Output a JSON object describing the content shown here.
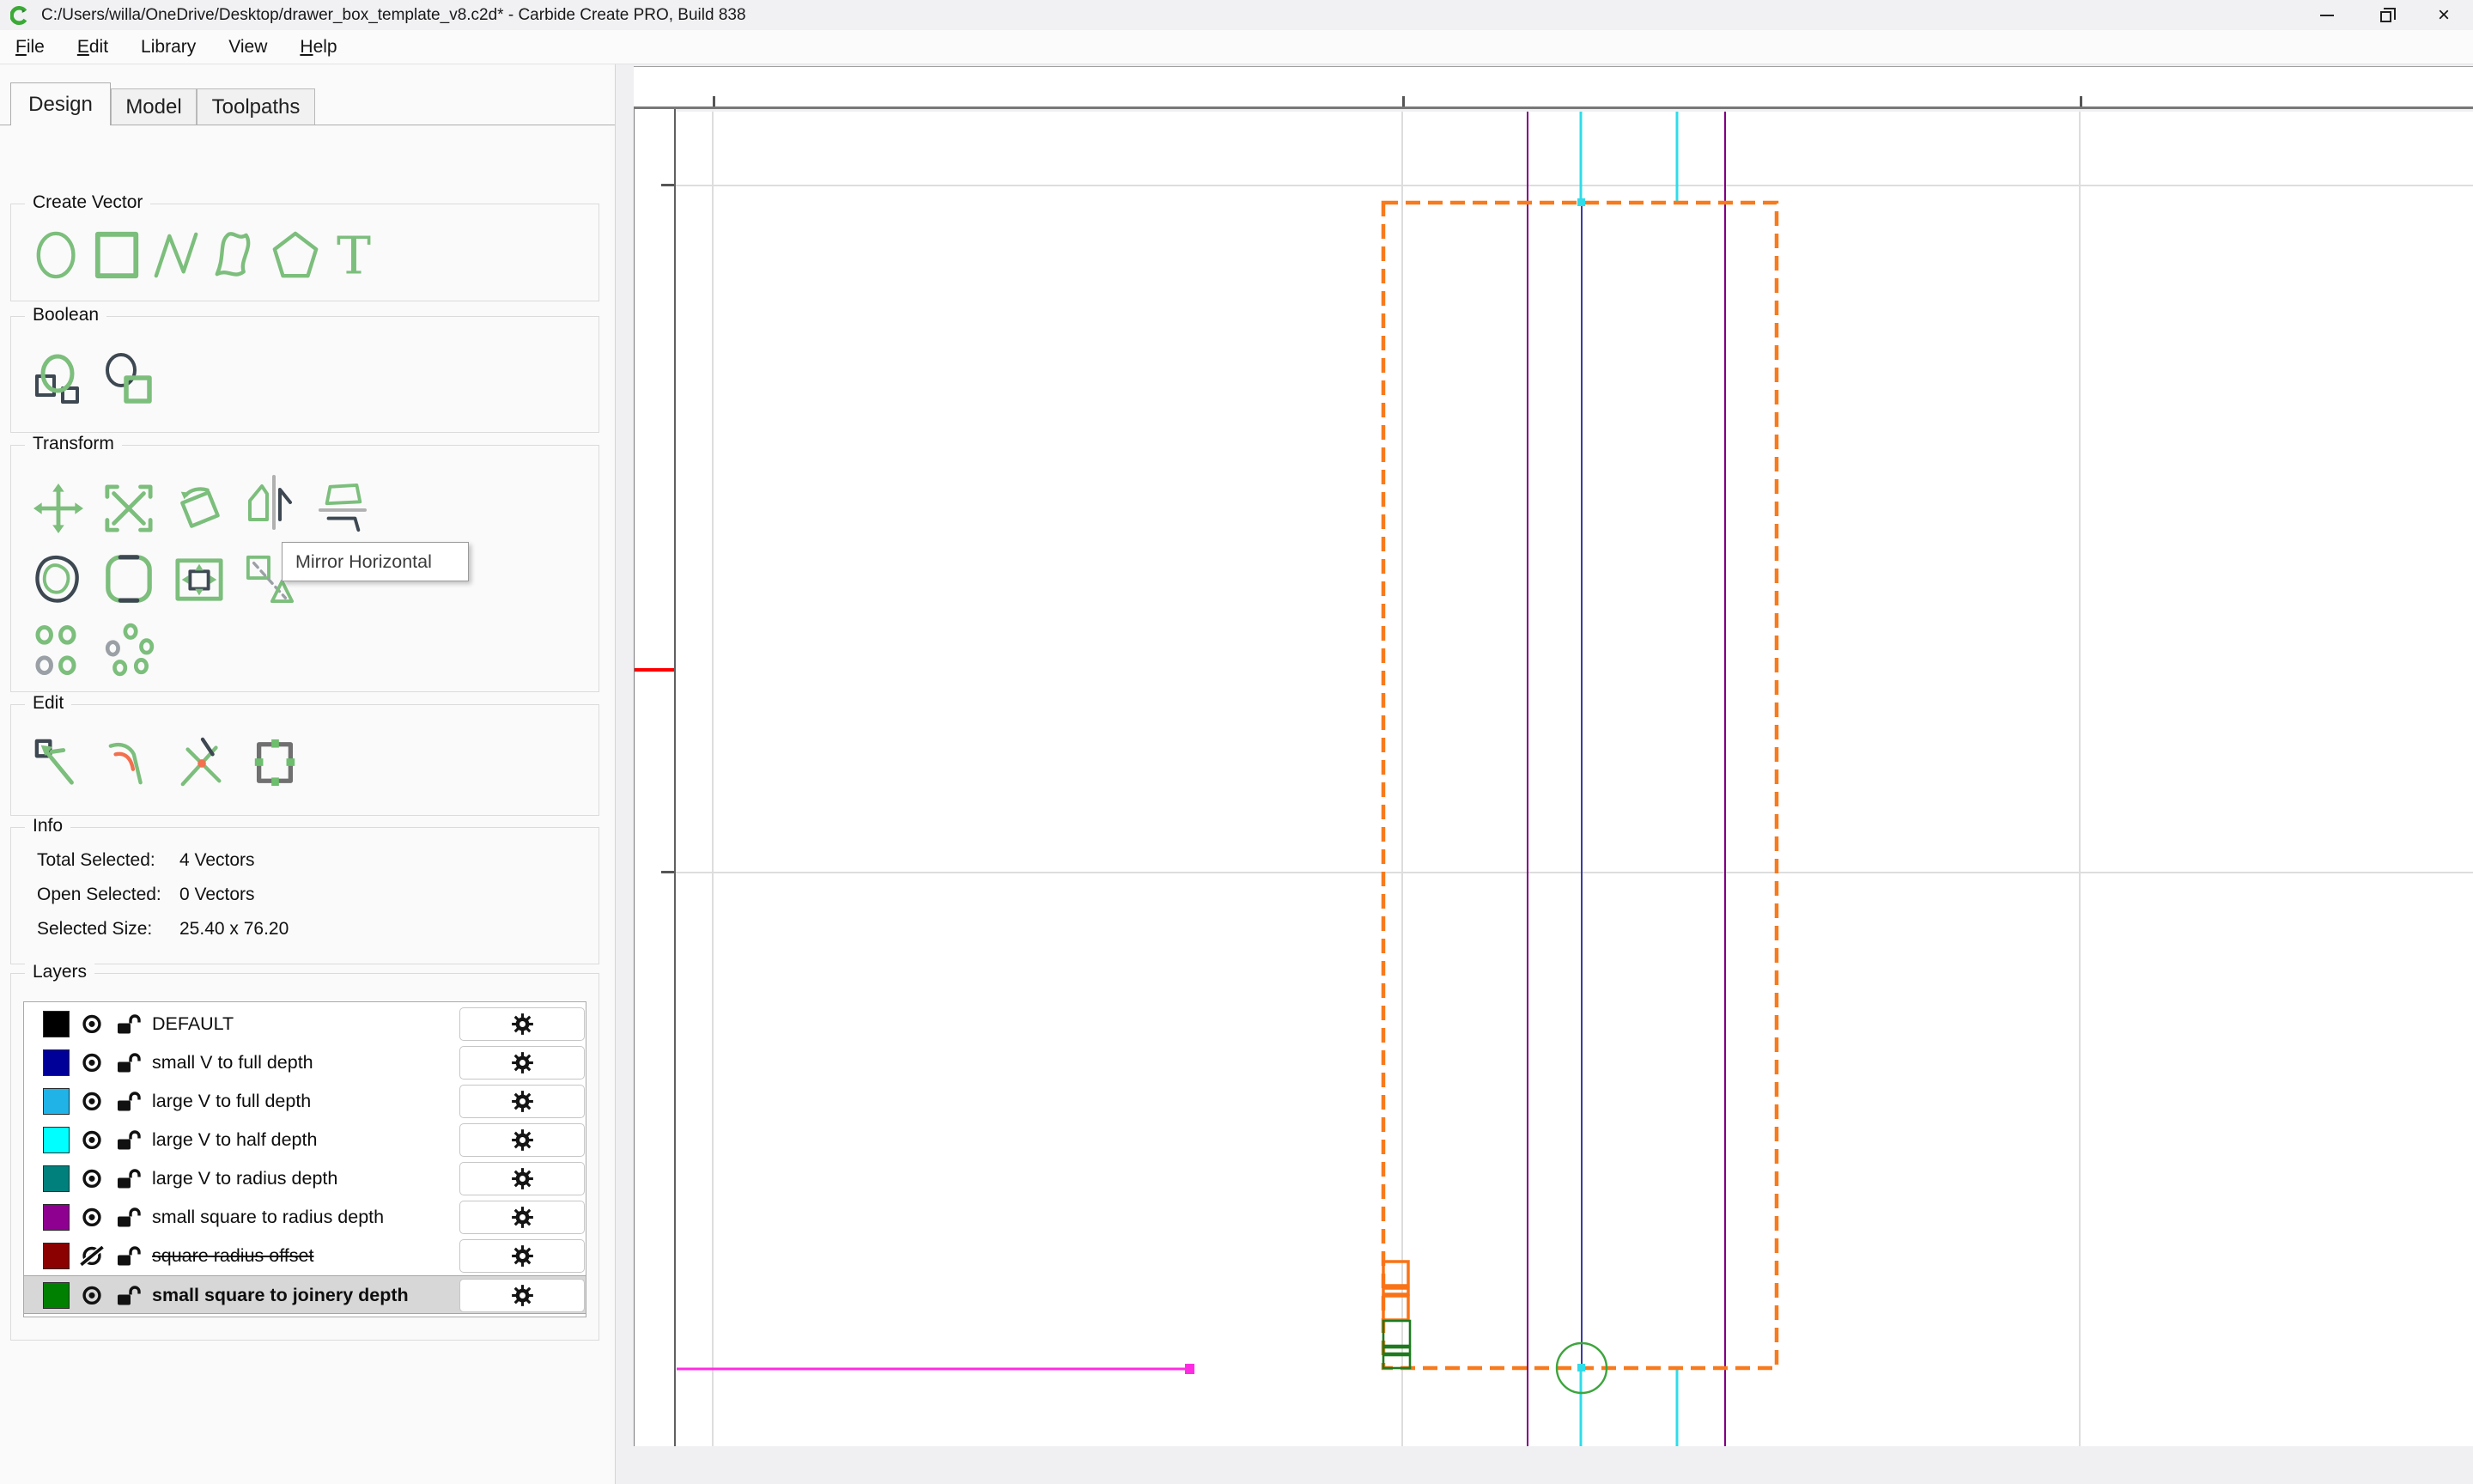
{
  "window": {
    "title": "C:/Users/willa/OneDrive/Desktop/drawer_box_template_v8.c2d* - Carbide Create PRO, Build 838",
    "controls": [
      "minimize-icon",
      "restore-icon",
      "close-icon"
    ]
  },
  "menu": {
    "items": [
      {
        "label": "File",
        "underline": 0
      },
      {
        "label": "Edit",
        "underline": 0
      },
      {
        "label": "Library"
      },
      {
        "label": "View"
      },
      {
        "label": "Help",
        "underline": 0
      }
    ]
  },
  "tabs": {
    "items": [
      "Design",
      "Model",
      "Toolpaths"
    ],
    "active": "Design"
  },
  "sections": {
    "create_vector": {
      "title": "Create Vector",
      "icons": [
        "circle-icon",
        "rectangle-icon",
        "polyline-icon",
        "curve-icon",
        "polygon-icon",
        "text-icon"
      ]
    },
    "boolean": {
      "title": "Boolean",
      "icons": [
        "boolean-union-icon",
        "boolean-subtract-icon"
      ]
    },
    "transform": {
      "title": "Transform",
      "rows": [
        [
          "move-icon",
          "scale-icon",
          "rotate-icon",
          "mirror-horizontal-icon",
          "mirror-vertical-icon"
        ],
        [
          "offset-icon",
          "round-corners-icon",
          "inset-icon",
          "trim-icon"
        ],
        [
          "linear-array-icon",
          "circular-array-icon"
        ]
      ],
      "tooltip": "Mirror Horizontal"
    },
    "edit": {
      "title": "Edit",
      "icons": [
        "node-edit-icon",
        "fillet-icon",
        "trim-vector-icon",
        "resize-icon"
      ]
    }
  },
  "info": {
    "title": "Info",
    "rows": [
      {
        "label": "Total Selected:",
        "value": "4 Vectors"
      },
      {
        "label": "Open Selected:",
        "value": "0 Vectors"
      },
      {
        "label": "Selected Size:",
        "value": "25.40 x 76.20"
      }
    ]
  },
  "layers": {
    "title": "Layers",
    "items": [
      {
        "name": "DEFAULT",
        "color": "#000000",
        "visible": true,
        "locked": false,
        "selected": false,
        "strikethrough": false
      },
      {
        "name": "small V to full depth",
        "color": "#000099",
        "visible": true,
        "locked": false,
        "selected": false,
        "strikethrough": false
      },
      {
        "name": "large V to full depth",
        "color": "#1FB3E8",
        "visible": true,
        "locked": false,
        "selected": false,
        "strikethrough": false
      },
      {
        "name": "large V to half depth",
        "color": "#00FFFF",
        "visible": true,
        "locked": false,
        "selected": false,
        "strikethrough": false
      },
      {
        "name": "large V to radius depth",
        "color": "#00807C",
        "visible": true,
        "locked": false,
        "selected": false,
        "strikethrough": false
      },
      {
        "name": "small square to radius depth",
        "color": "#8E0090",
        "visible": true,
        "locked": false,
        "selected": false,
        "strikethrough": false
      },
      {
        "name": "square radius offset",
        "color": "#8B0000",
        "visible": false,
        "locked": false,
        "selected": false,
        "strikethrough": true
      },
      {
        "name": "small square to joinery depth",
        "color": "#008000",
        "visible": true,
        "locked": false,
        "selected": true,
        "strikethrough": false
      }
    ]
  },
  "canvas": {
    "colors": {
      "guide_purple": "#800080",
      "guide_cyan": "#2FDCE8",
      "centerline_blue": "#3C3CA0",
      "boundary_orange": "#F87A1C",
      "construction_magenta": "#FF2BE2",
      "circle_green": "#3DA53D",
      "joinery_green": "#1E7A1E",
      "pocket_orange": "#F97316",
      "tick_red": "#FF0000",
      "grid_gray": "#DDDDDD",
      "tool_green": "#7CBE7C",
      "tool_dark": "#3D4852"
    }
  }
}
